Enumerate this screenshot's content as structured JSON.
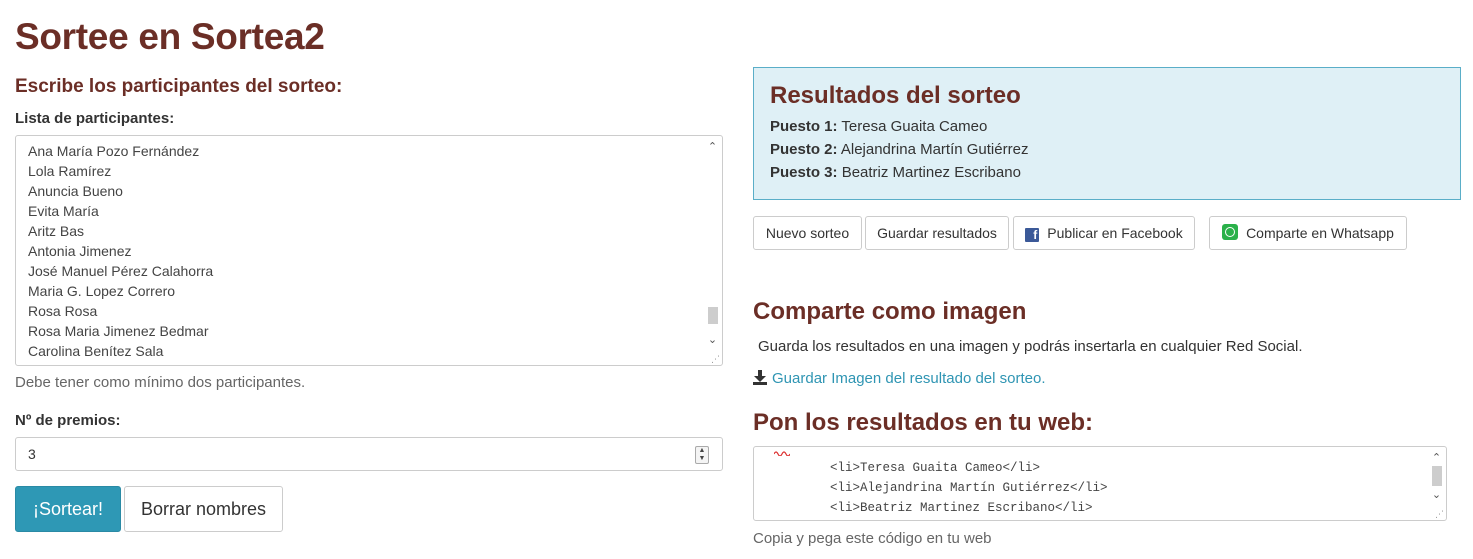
{
  "page": {
    "title": "Sortee en Sortea2"
  },
  "form": {
    "section_heading": "Escribe los participantes del sorteo:",
    "list_label": "Lista de participantes:",
    "participants": [
      "Ana María Pozo Fernández",
      "Lola Ramírez",
      "Anuncia Bueno",
      "Evita María",
      "Aritz Bas",
      "Antonia Jimenez",
      "José Manuel Pérez Calahorra",
      "Maria G. Lopez Correro",
      "Rosa Rosa",
      "Rosa Maria Jimenez Bedmar",
      "Carolina Benítez Sala"
    ],
    "list_scroll_position": 0.95,
    "help_text": "Debe tener como mínimo dos participantes.",
    "prizes_label": "Nº de premios:",
    "prizes_value": "3",
    "draw_button": "¡Sortear!",
    "clear_button": "Borrar nombres"
  },
  "results": {
    "title": "Resultados del sorteo",
    "entries": [
      {
        "position": "Puesto 1:",
        "name": "Teresa Guaita Cameo"
      },
      {
        "position": "Puesto 2:",
        "name": "Alejandrina Martín Gutiérrez"
      },
      {
        "position": "Puesto 3:",
        "name": "Beatriz Martinez Escribano"
      }
    ]
  },
  "actions": {
    "new_draw": "Nuevo sorteo",
    "save_results": "Guardar resultados",
    "facebook": "Publicar en Facebook",
    "whatsapp": "Comparte en Whatsapp"
  },
  "share_image": {
    "heading": "Comparte como imagen",
    "description": "Guarda los resultados en una imagen y podrás insertarla en cualquier Red Social.",
    "download_link": "Guardar Imagen del resultado del sorteo."
  },
  "embed": {
    "heading": "Pon los resultados en tu web:",
    "code_lines": [
      "<li>Teresa Guaita Cameo</li>",
      "<li>Alejandrina Martín Gutiérrez</li>",
      "<li>Beatriz Martinez Escribano</li>"
    ],
    "copy_note": "Copia y pega este código en tu web"
  },
  "icons": {
    "facebook": "facebook-icon",
    "whatsapp": "whatsapp-icon",
    "download": "download-icon"
  },
  "colors": {
    "brand_heading": "#6b2e26",
    "primary_button": "#2e98b5",
    "results_panel_bg": "#dff0f6",
    "results_panel_border": "#5aaec8",
    "link": "#2f95b3",
    "facebook": "#3b5998",
    "whatsapp": "#2ab14a"
  }
}
